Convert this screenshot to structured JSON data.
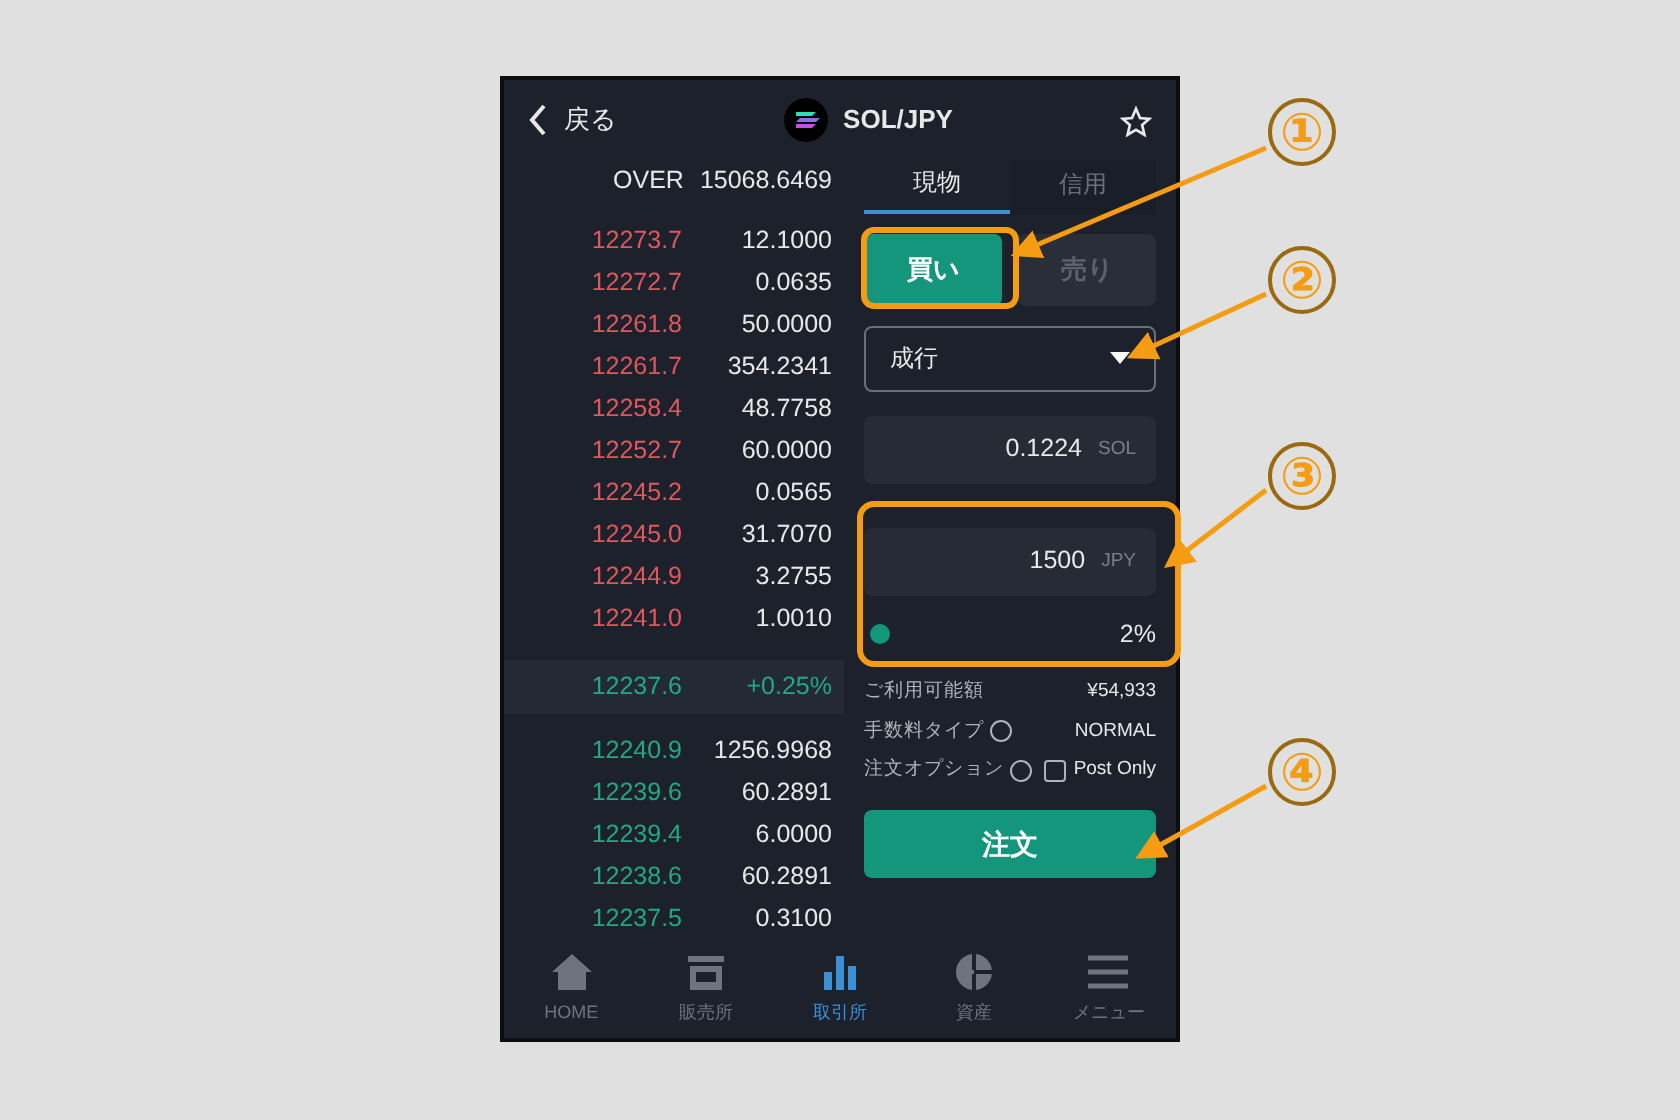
{
  "header": {
    "back_label": "戻る",
    "pair": "SOL/JPY",
    "favorite": false
  },
  "order_book": {
    "over_label": "OVER",
    "over_value": "15068.6469",
    "asks": [
      {
        "price": "12273.7",
        "amount": "12.1000"
      },
      {
        "price": "12272.7",
        "amount": "0.0635"
      },
      {
        "price": "12261.8",
        "amount": "50.0000"
      },
      {
        "price": "12261.7",
        "amount": "354.2341"
      },
      {
        "price": "12258.4",
        "amount": "48.7758"
      },
      {
        "price": "12252.7",
        "amount": "60.0000"
      },
      {
        "price": "12245.2",
        "amount": "0.0565"
      },
      {
        "price": "12245.0",
        "amount": "31.7070"
      },
      {
        "price": "12244.9",
        "amount": "3.2755"
      },
      {
        "price": "12241.0",
        "amount": "1.0010"
      }
    ],
    "last_price": "12237.6",
    "change": "+0.25%",
    "bids": [
      {
        "price": "12240.9",
        "amount": "1256.9968"
      },
      {
        "price": "12239.6",
        "amount": "60.2891"
      },
      {
        "price": "12239.4",
        "amount": "6.0000"
      },
      {
        "price": "12238.6",
        "amount": "60.2891"
      },
      {
        "price": "12237.5",
        "amount": "0.3100"
      }
    ]
  },
  "tabs": [
    {
      "label": "現物",
      "selected": true
    },
    {
      "label": "信用",
      "selected": false
    }
  ],
  "sides": [
    {
      "label": "買い",
      "selected": true
    },
    {
      "label": "売り",
      "selected": false
    }
  ],
  "order_type": {
    "value": "成行"
  },
  "quantity": {
    "value": "0.1224",
    "unit": "SOL"
  },
  "amount": {
    "value": "1500",
    "unit": "JPY"
  },
  "slider": {
    "level": 0.02,
    "reading": "2%"
  },
  "info": [
    {
      "label": "ご利用可能額",
      "value": "¥54,933",
      "kind": "text"
    },
    {
      "label": "手数料タイプ",
      "value": "NORMAL",
      "kind": "info"
    },
    {
      "label": "注文オプション",
      "value": "Post Only",
      "kind": "checkbox",
      "checked": false
    }
  ],
  "submit_label": "注文",
  "nav": [
    {
      "label": "HOME",
      "kind": "home",
      "selected": false
    },
    {
      "label": "販売所",
      "kind": "store",
      "selected": false
    },
    {
      "label": "取引所",
      "kind": "chart",
      "selected": true
    },
    {
      "label": "資産",
      "kind": "pie",
      "selected": false
    },
    {
      "label": "メニュー",
      "kind": "menu",
      "selected": false
    }
  ],
  "annotations": [
    {
      "label": "①"
    },
    {
      "label": "②"
    },
    {
      "label": "③"
    },
    {
      "label": "④"
    }
  ]
}
